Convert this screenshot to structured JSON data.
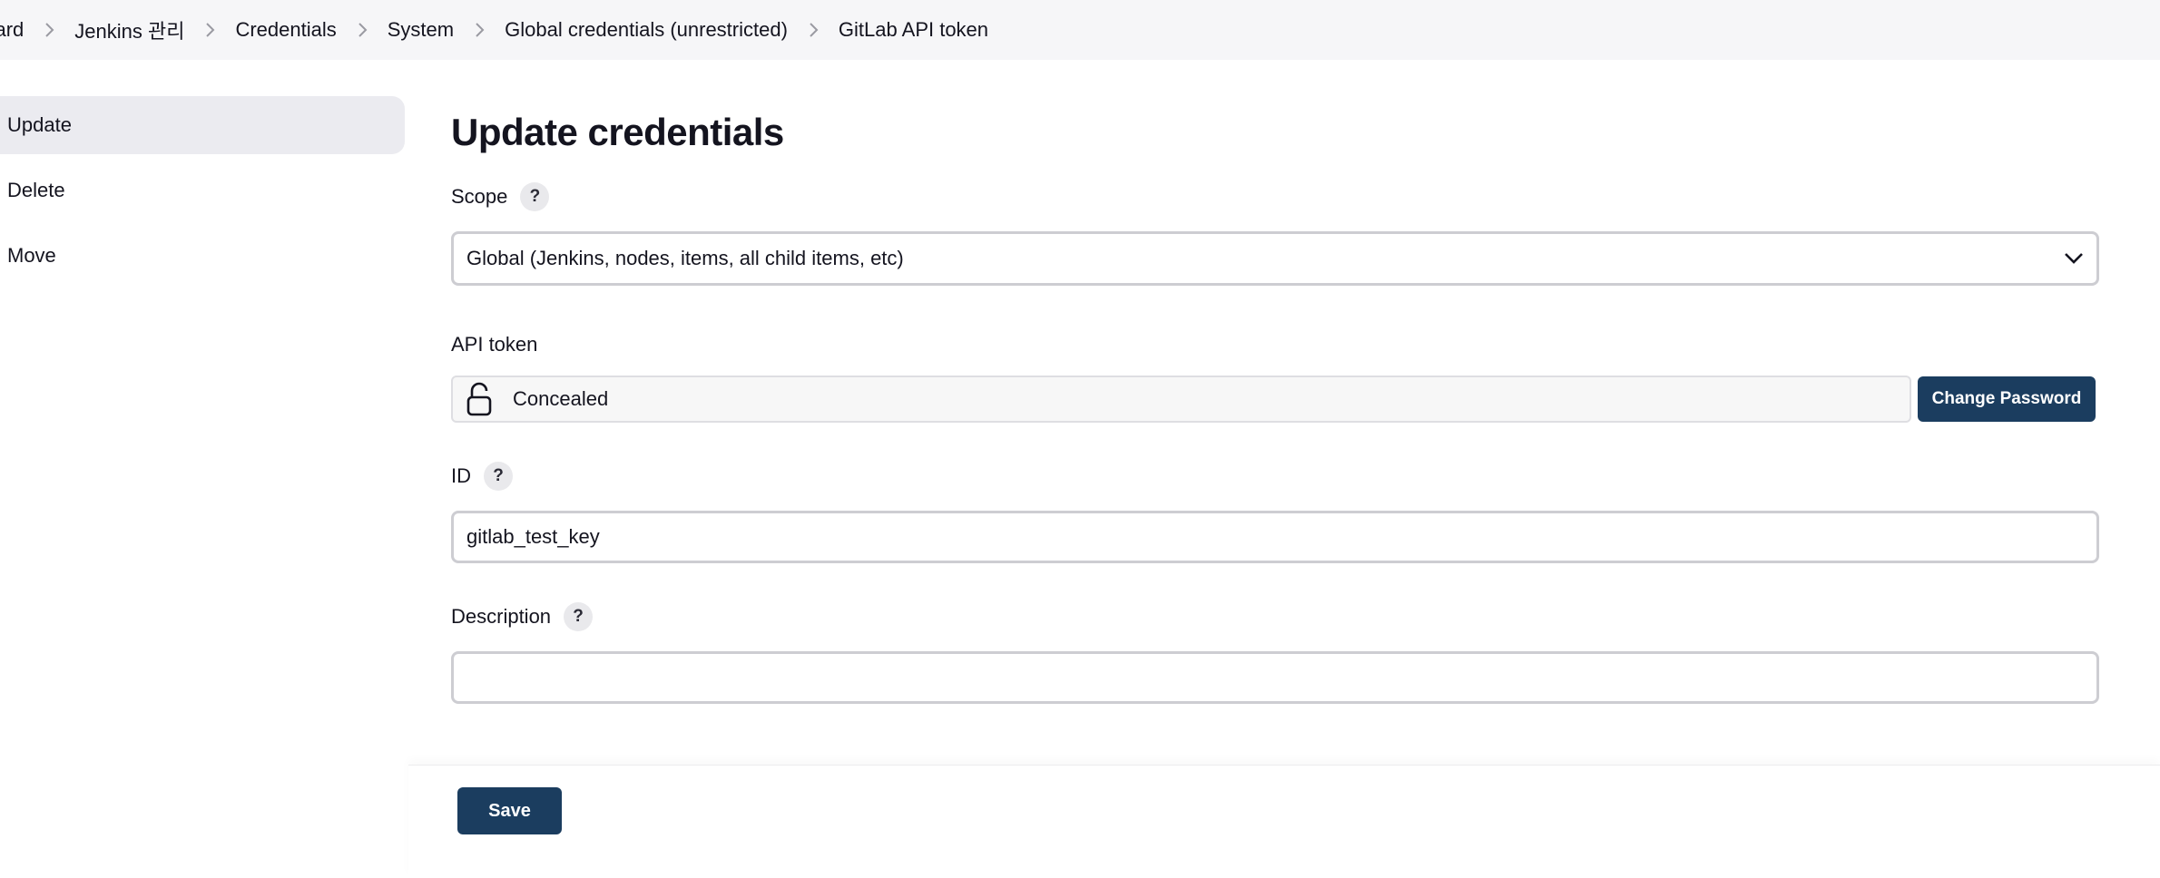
{
  "breadcrumb": {
    "items": [
      "board",
      "Jenkins 관리",
      "Credentials",
      "System",
      "Global credentials (unrestricted)",
      "GitLab API token"
    ]
  },
  "side_panel": {
    "items": [
      {
        "label": "Update",
        "active": true
      },
      {
        "label": "Delete",
        "active": false
      },
      {
        "label": "Move",
        "active": false
      }
    ]
  },
  "form": {
    "title": "Update credentials",
    "scope": {
      "label": "Scope",
      "help": "?",
      "value": "Global (Jenkins, nodes, items, all child items, etc)"
    },
    "api_token": {
      "label": "API token",
      "value": "Concealed",
      "change_button": "Change Password"
    },
    "id": {
      "label": "ID",
      "help": "?",
      "value": "gitlab_test_key"
    },
    "description": {
      "label": "Description",
      "help": "?",
      "value": ""
    }
  },
  "actions": {
    "save_label": "Save"
  },
  "colors": {
    "primary_button": "#1b3d5f",
    "breadcrumb_bg": "#f6f6f8",
    "active_side_item": "#ebebf0"
  },
  "icons": {
    "breadcrumb_separator": "chevron-right-icon",
    "select_caret": "chevron-down-icon",
    "secret": "lock-icon"
  }
}
